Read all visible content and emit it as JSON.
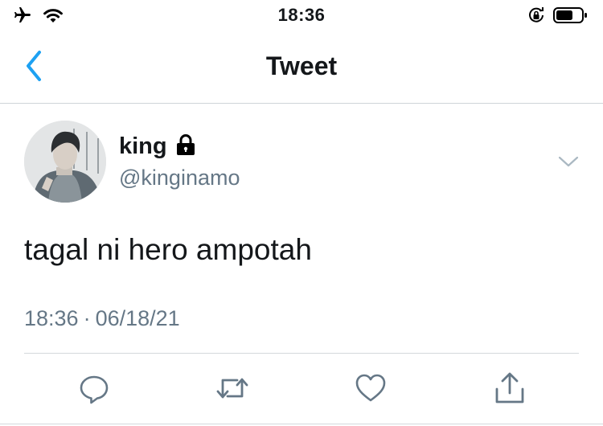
{
  "status_bar": {
    "time": "18:36",
    "icons": [
      "airplane-icon",
      "wifi-icon",
      "orientation-lock-icon",
      "battery-icon"
    ]
  },
  "nav": {
    "title": "Tweet",
    "back_icon": "chevron-left-icon",
    "accent_color": "#1DA1F2"
  },
  "tweet": {
    "display_name": "king",
    "protected_icon": "lock-icon",
    "handle": "@kinginamo",
    "text": "tagal ni hero ampotah",
    "time": "18:36",
    "separator": "·",
    "date": "06/18/21"
  },
  "actions": [
    {
      "name": "reply",
      "icon": "reply-icon"
    },
    {
      "name": "retweet",
      "icon": "retweet-icon"
    },
    {
      "name": "like",
      "icon": "heart-icon"
    },
    {
      "name": "share",
      "icon": "share-icon"
    }
  ],
  "colors": {
    "text": "#14171A",
    "secondary_text": "#657786",
    "icon_gray": "#657786",
    "accent": "#1DA1F2"
  }
}
